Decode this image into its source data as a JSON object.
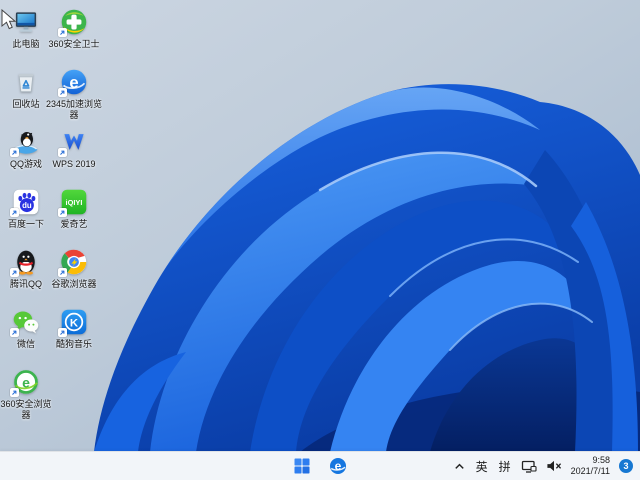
{
  "desktop": {
    "icons": [
      {
        "name": "this-pc",
        "label": "此电脑",
        "col": 0,
        "row": 0,
        "shortcut": false
      },
      {
        "name": "360-safeguard",
        "label": "360安全卫士",
        "col": 1,
        "row": 0,
        "shortcut": true
      },
      {
        "name": "recycle-bin",
        "label": "回收站",
        "col": 0,
        "row": 1,
        "shortcut": false
      },
      {
        "name": "2345-browser",
        "label": "2345加速浏览器",
        "col": 1,
        "row": 1,
        "shortcut": true
      },
      {
        "name": "qq-games",
        "label": "QQ游戏",
        "col": 0,
        "row": 2,
        "shortcut": true
      },
      {
        "name": "wps-2019",
        "label": "WPS 2019",
        "col": 1,
        "row": 2,
        "shortcut": true
      },
      {
        "name": "baidu",
        "label": "百度一下",
        "col": 0,
        "row": 3,
        "shortcut": true
      },
      {
        "name": "iqiyi",
        "label": "爱奇艺",
        "col": 1,
        "row": 3,
        "shortcut": true
      },
      {
        "name": "tencent-qq",
        "label": "腾讯QQ",
        "col": 0,
        "row": 4,
        "shortcut": true
      },
      {
        "name": "chrome",
        "label": "谷歌浏览器",
        "col": 1,
        "row": 4,
        "shortcut": true
      },
      {
        "name": "wechat",
        "label": "微信",
        "col": 0,
        "row": 5,
        "shortcut": true
      },
      {
        "name": "kugou-music",
        "label": "酷狗音乐",
        "col": 1,
        "row": 5,
        "shortcut": true
      },
      {
        "name": "360-browser",
        "label": "360安全浏览器",
        "col": 0,
        "row": 6,
        "shortcut": true
      }
    ]
  },
  "taskbar": {
    "tray": {
      "ime_english": "英",
      "ime_pinyin": "拼",
      "time": "9:58",
      "date": "2021/7/11",
      "badge_count": "3"
    }
  },
  "colors": {
    "taskbar_bg": "#f2f5f9",
    "badge_blue": "#1778d2",
    "bloom_bright": "#3b87f3",
    "bloom_mid": "#1158d2",
    "bloom_dark": "#072d7e",
    "background_top": "#ccd6e2",
    "background_bottom": "#a4b6ca"
  }
}
